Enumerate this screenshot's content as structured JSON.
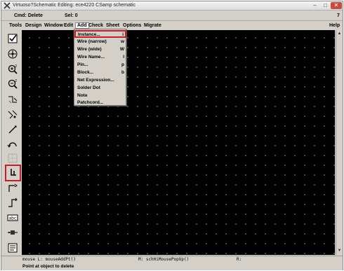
{
  "window": {
    "title": "Virtuoso?Schematic Editing: ece4220 CSamp schematic",
    "controls": {
      "minimize": "–",
      "maximize": "□",
      "close": "✕"
    }
  },
  "cmdbar": {
    "cmd": "Cmd: Delete",
    "sel": "Sel: 0",
    "number": "7"
  },
  "menubar": {
    "items": [
      "Tools",
      "Design",
      "Window",
      "Edit",
      "Add",
      "Check",
      "Sheet",
      "Options",
      "Migrate",
      "Help"
    ],
    "active": "Add"
  },
  "add_menu": {
    "items": [
      {
        "label": "Instance...",
        "key": "i"
      },
      {
        "label": "Wire (narrow)",
        "key": "w"
      },
      {
        "label": "Wire (wide)",
        "key": "W"
      },
      {
        "label": "Wire Name...",
        "key": "l"
      },
      {
        "label": "Pin...",
        "key": "p"
      },
      {
        "label": "Block...",
        "key": "b"
      },
      {
        "label": "Net Expression...",
        "key": ""
      },
      {
        "label": "Solder Dot",
        "key": ""
      },
      {
        "label": "Note",
        "key": ""
      },
      {
        "label": "Patchcord...",
        "key": ""
      }
    ]
  },
  "toolbar": {
    "icons": [
      "checkbox-icon",
      "zoom-fit-icon",
      "zoom-in-2-icon",
      "zoom-out-2-icon",
      "stretch-icon",
      "copy-icon",
      "wire-narrow-icon",
      "undo-arc-icon",
      "grid-placeholder-icon",
      "instance-icon",
      "pin-step-icon",
      "wire-step-icon",
      "label-abc-icon",
      "property-icon",
      "note-icon",
      "redo-icon"
    ]
  },
  "statusbar": {
    "left": "mouse L: mouseAddPt()",
    "middle": "M: schHiMousePopUp()",
    "right": "R:"
  },
  "prompt": "Point at object to delete",
  "colors": {
    "canvas": "#000000",
    "grid_dot": "#5a5a5a",
    "chrome": "#d4d0c8",
    "highlight": "#c21f2a"
  }
}
